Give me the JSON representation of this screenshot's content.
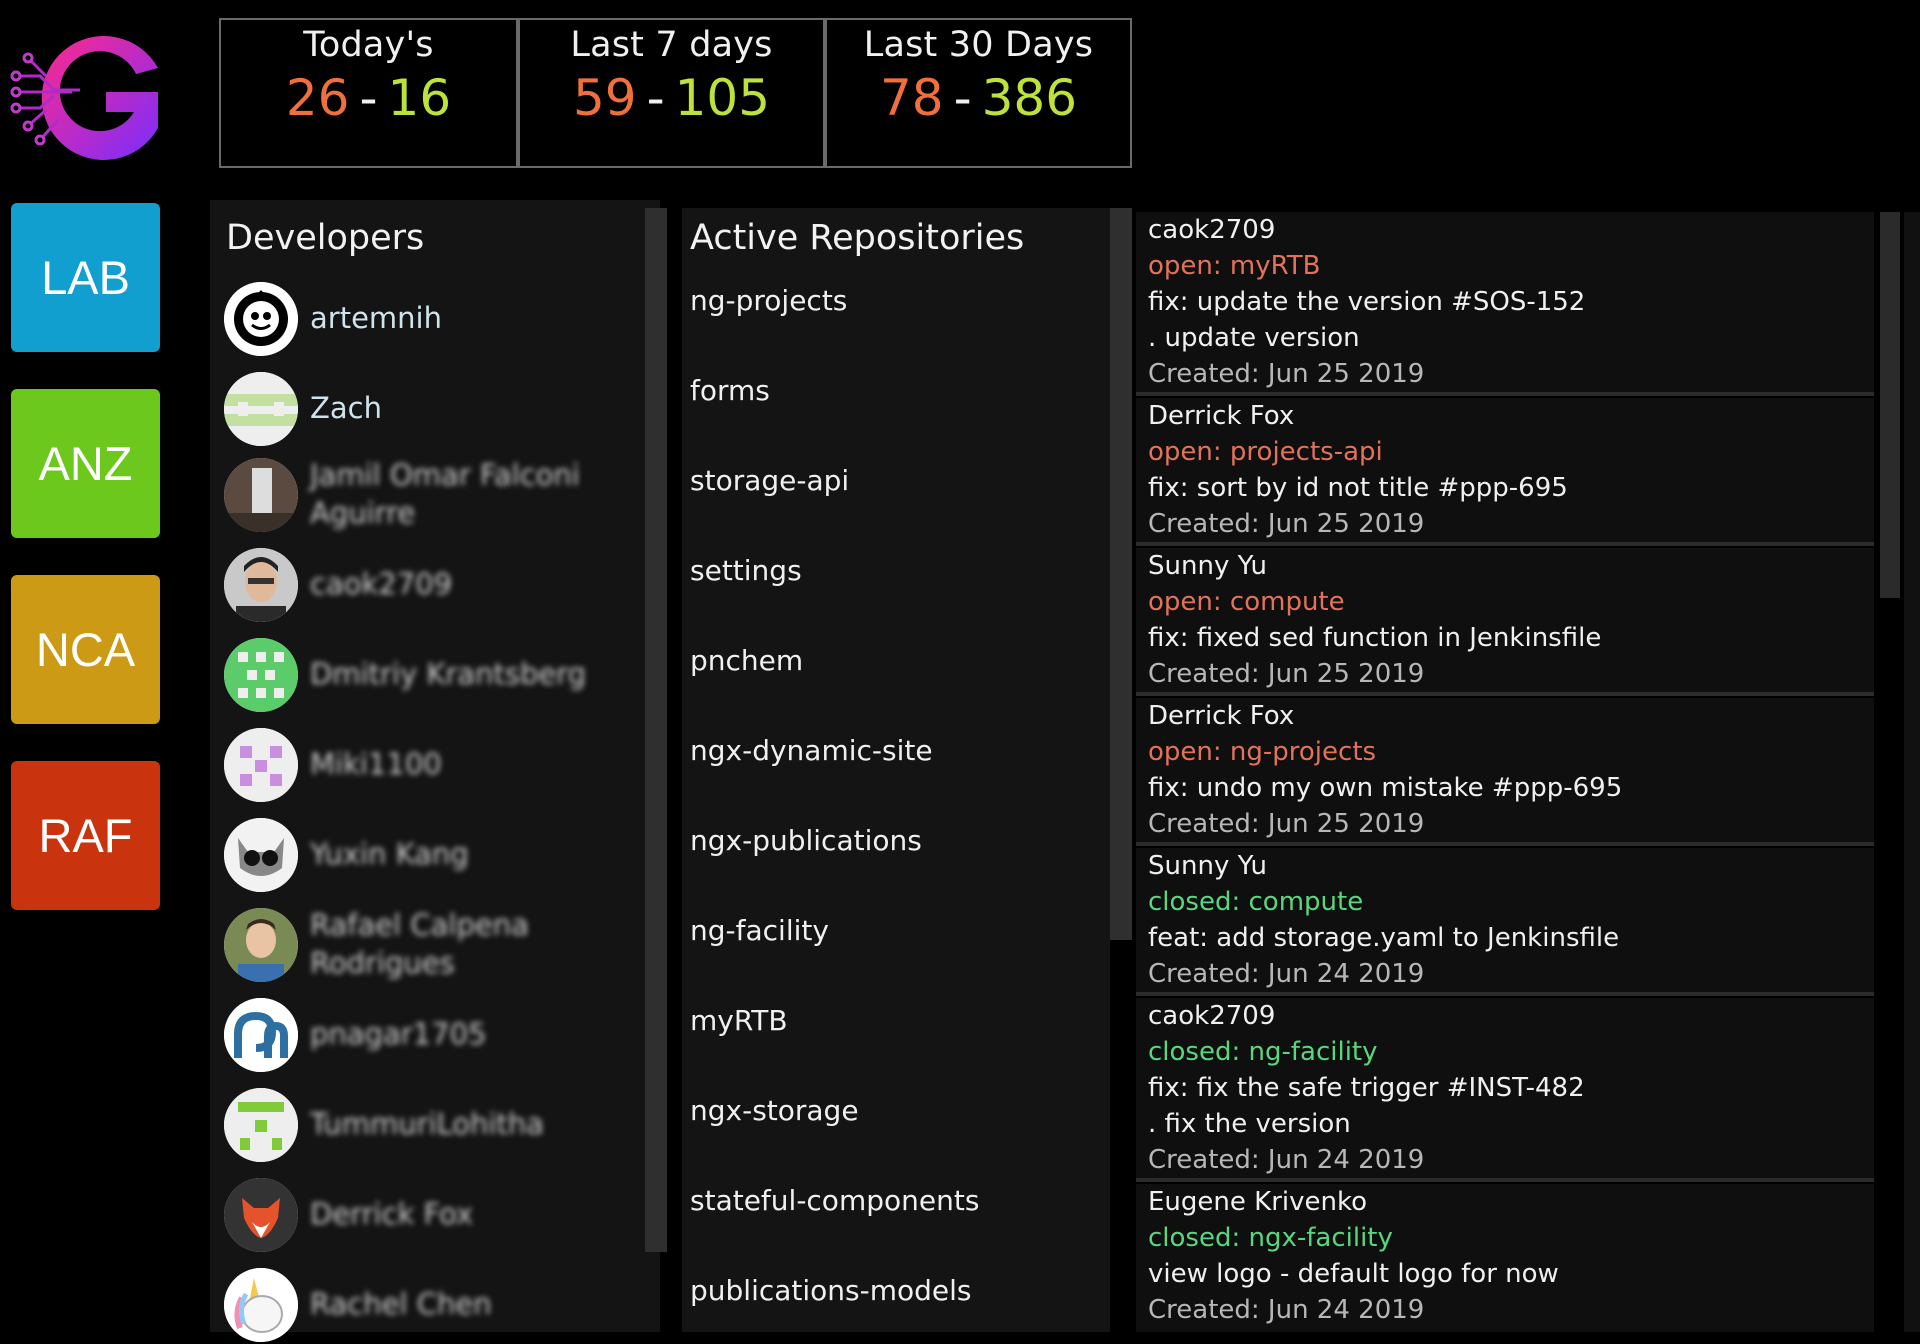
{
  "logo": {
    "letter": "G",
    "colors": [
      "#ff2a8a",
      "#7a2cff"
    ]
  },
  "teams": [
    {
      "label": "LAB",
      "color": "#119fcf"
    },
    {
      "label": "ANZ",
      "color": "#6cc81c"
    },
    {
      "label": "NCA",
      "color": "#cc9a15"
    },
    {
      "label": "RAF",
      "color": "#c9330e"
    }
  ],
  "stats": [
    {
      "label": "Today's",
      "open": "26",
      "closed": "16"
    },
    {
      "label": "Last 7 days",
      "open": "59",
      "closed": "105"
    },
    {
      "label": "Last 30 Days",
      "open": "78",
      "closed": "386"
    }
  ],
  "developers": {
    "title": "Developers",
    "items": [
      {
        "name": "artemnih",
        "avatar": "artemnih-avatar",
        "blurred": false
      },
      {
        "name": "Zach",
        "avatar": "zach-avatar",
        "blurred": false
      },
      {
        "name": "Jamil Omar Falconi Aguirre",
        "avatar": "photo-avatar",
        "blurred": true
      },
      {
        "name": "caok2709",
        "avatar": "photo-avatar",
        "blurred": true
      },
      {
        "name": "Dmitriy Krantsberg",
        "avatar": "identicon-avatar",
        "blurred": true
      },
      {
        "name": "Miki1100",
        "avatar": "identicon-avatar",
        "blurred": true
      },
      {
        "name": "Yuxin Kang",
        "avatar": "cat-avatar",
        "blurred": true
      },
      {
        "name": "Rafael Calpena Rodrigues",
        "avatar": "photo-avatar",
        "blurred": true
      },
      {
        "name": "pnagar1705",
        "avatar": "logo-avatar",
        "blurred": true
      },
      {
        "name": "TummuriLohitha",
        "avatar": "identicon-avatar",
        "blurred": true
      },
      {
        "name": "Derrick Fox",
        "avatar": "fox-avatar",
        "blurred": true
      },
      {
        "name": "Rachel Chen",
        "avatar": "unicorn-avatar",
        "blurred": true
      }
    ]
  },
  "repos": {
    "title": "Active Repositories",
    "items": [
      "ng-projects",
      "forms",
      "storage-api",
      "settings",
      "pnchem",
      "ngx-dynamic-site",
      "ngx-publications",
      "ng-facility",
      "myRTB",
      "ngx-storage",
      "stateful-components",
      "publications-models"
    ]
  },
  "prs": [
    {
      "author": "caok2709",
      "status": "open: myRTB",
      "state": "open",
      "lines": [
        "fix: update the version #SOS-152",
        ". update version"
      ],
      "created": "Created: Jun 25 2019"
    },
    {
      "author": "Derrick Fox",
      "status": "open: projects-api",
      "state": "open",
      "lines": [
        "fix: sort by id not title #ppp-695"
      ],
      "created": "Created: Jun 25 2019"
    },
    {
      "author": "Sunny Yu",
      "status": "open: compute",
      "state": "open",
      "lines": [
        "fix: fixed sed function in Jenkinsfile"
      ],
      "created": "Created: Jun 25 2019"
    },
    {
      "author": "Derrick Fox",
      "status": "open: ng-projects",
      "state": "open",
      "lines": [
        "fix: undo my own mistake #ppp-695"
      ],
      "created": "Created: Jun 25 2019"
    },
    {
      "author": "Sunny Yu",
      "status": "closed: compute",
      "state": "closed",
      "lines": [
        "feat: add storage.yaml to Jenkinsfile"
      ],
      "created": "Created: Jun 24 2019"
    },
    {
      "author": "caok2709",
      "status": "closed: ng-facility",
      "state": "closed",
      "lines": [
        "fix: fix the safe trigger #INST-482",
        ". fix the version"
      ],
      "created": "Created: Jun 24 2019"
    },
    {
      "author": "Eugene Krivenko",
      "status": "closed: ngx-facility",
      "state": "closed",
      "lines": [
        "view logo - default logo for now"
      ],
      "created": "Created: Jun 24 2019"
    }
  ]
}
